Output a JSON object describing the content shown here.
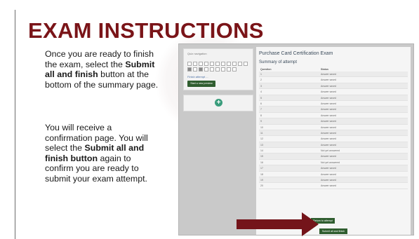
{
  "slide": {
    "title": "EXAM INSTRUCTIONS",
    "para1": {
      "t1": "Once you are ready to finish the exam, select the ",
      "b1": "Submit all and finish",
      "t2": " button at the bottom of the summary page."
    },
    "para2": {
      "t1": "You will receive a confirmation page. You will select the ",
      "b1": "Submit all and finish button",
      "t2": " again to confirm you are ready to submit your exam attempt."
    }
  },
  "colors": {
    "title": "#7a1418",
    "arrow": "#74141a",
    "button": "#2f5d2f"
  },
  "screenshot": {
    "exam_title": "Purchase Card Certification Exam",
    "summary_label": "Summary of attempt",
    "col_question": "Question",
    "col_status": "Status",
    "left": {
      "panel_title": "Quiz navigation",
      "finish_link": "Finish attempt ...",
      "start_new": "Start a new preview",
      "plus_icon": "+"
    },
    "rows": [
      {
        "q": "1",
        "s": "Answer saved"
      },
      {
        "q": "2",
        "s": "Answer saved"
      },
      {
        "q": "3",
        "s": "Answer saved"
      },
      {
        "q": "4",
        "s": "Answer saved"
      },
      {
        "q": "5",
        "s": "Answer saved"
      },
      {
        "q": "6",
        "s": "Answer saved"
      },
      {
        "q": "7",
        "s": "Answer saved"
      },
      {
        "q": "8",
        "s": "Answer saved"
      },
      {
        "q": "9",
        "s": "Answer saved"
      },
      {
        "q": "10",
        "s": "Answer saved"
      },
      {
        "q": "11",
        "s": "Answer saved"
      },
      {
        "q": "12",
        "s": "Answer saved"
      },
      {
        "q": "13",
        "s": "Answer saved"
      },
      {
        "q": "14",
        "s": "Not yet answered"
      },
      {
        "q": "15",
        "s": "Answer saved"
      },
      {
        "q": "16",
        "s": "Not yet answered"
      },
      {
        "q": "17",
        "s": "Answer saved"
      },
      {
        "q": "18",
        "s": "Answer saved"
      },
      {
        "q": "19",
        "s": "Answer saved"
      },
      {
        "q": "20",
        "s": "Answer saved"
      }
    ],
    "return_btn": "Return to attempt",
    "submit_btn": "Submit all and finish"
  }
}
